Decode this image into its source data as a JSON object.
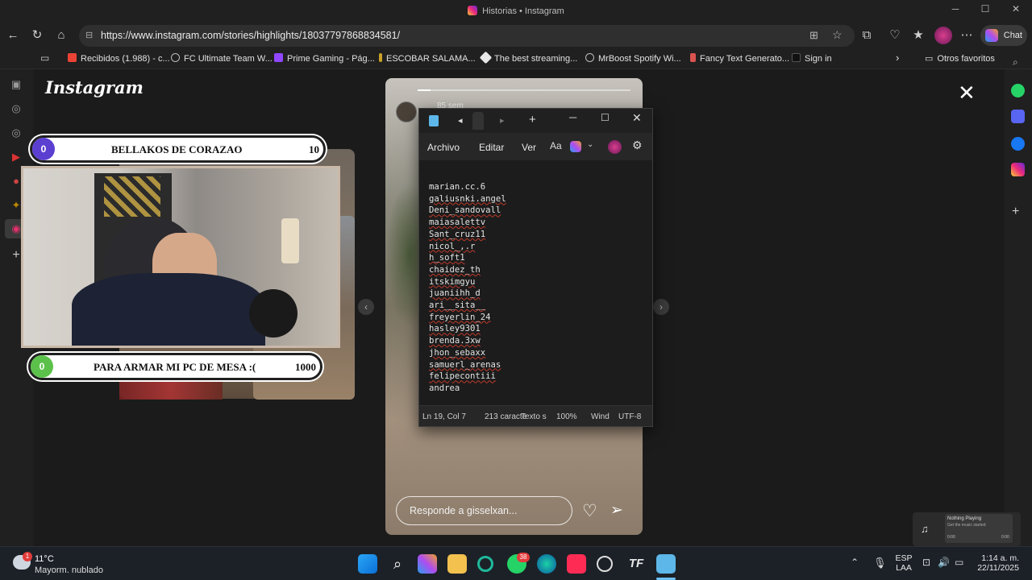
{
  "window": {
    "title": "Historias • Instagram"
  },
  "address": {
    "url": "https://www.instagram.com/stories/highlights/18037797868834581/"
  },
  "chat_label": "Chat",
  "bookmarks": [
    {
      "label": "Recibidos (1.988) - c...",
      "color": "#ea4335"
    },
    {
      "label": "FC Ultimate Team W...",
      "color": "#8a8a8a"
    },
    {
      "label": "Prime Gaming - Pág...",
      "color": "#9146ff"
    },
    {
      "label": "ESCOBAR SALAMA...",
      "color": "#c9a227"
    },
    {
      "label": "The best streaming...",
      "color": "#e8e8e8"
    },
    {
      "label": "MrBoost Spotify Wi...",
      "color": "#8a8a8a"
    },
    {
      "label": "Fancy Text Generato...",
      "color": "#d9534f"
    },
    {
      "label": "Sign in",
      "color": "#1a1a1a"
    }
  ],
  "bookmarks_other": "Otros favoritos",
  "instagram": {
    "logo": "Instagram",
    "goal1": {
      "start": "0",
      "label": "BELLAKOS DE CORAZAO",
      "end": "10"
    },
    "goal2": {
      "start": "0",
      "label": "PARA ARMAR MI PC DE MESA :(",
      "end": "1000"
    },
    "story_time": "85 sem",
    "reply_placeholder": "Responde a gisselxan...",
    "progress_fraction": 0.06
  },
  "notepad": {
    "menu": [
      "Archivo",
      "Editar",
      "Ver"
    ],
    "lines": [
      {
        "text": "marian.cc.6",
        "sq": false
      },
      {
        "text": "galiusnki.angel",
        "sq": true
      },
      {
        "text": "Deni_sandovall",
        "sq": true
      },
      {
        "text": "maiasalettv",
        "sq": true
      },
      {
        "text": "Sant_cruz11",
        "sq": true
      },
      {
        "text": "nicol_,.r",
        "sq": true
      },
      {
        "text": "h_soft1",
        "sq": true
      },
      {
        "text": "chaidez_th",
        "sq": true
      },
      {
        "text": "itskimgyu",
        "sq": true
      },
      {
        "text": "juaniihh_d",
        "sq": true
      },
      {
        "text": "ari__sita__",
        "sq": true
      },
      {
        "text": "freyerlin_24",
        "sq": true
      },
      {
        "text": "hasley9301",
        "sq": true
      },
      {
        "text": "brenda.3xw",
        "sq": true
      },
      {
        "text": "jhon_sebaxx",
        "sq": true
      },
      {
        "text": "samuerl_arenas",
        "sq": true
      },
      {
        "text": "felipecontiii",
        "sq": true
      },
      {
        "text": "andrea",
        "sq": false
      }
    ],
    "status": {
      "pos": "Ln 19, Col 7",
      "chars": "213 caracte",
      "format": "Texto s",
      "zoom": "100%",
      "eol": "Wind",
      "encoding": "UTF-8"
    }
  },
  "media": {
    "title": "Nothing Playing",
    "subtitle": "Get the music started",
    "time_start": "0:00",
    "time_end": "0:00"
  },
  "taskbar": {
    "weather_temp": "11°C",
    "weather_desc": "Mayorm. nublado",
    "weather_badge": "1",
    "whatsapp_badge": "38",
    "lang1": "ESP",
    "lang2": "LAA",
    "time": "1:14 a. m.",
    "date": "22/11/2025"
  }
}
